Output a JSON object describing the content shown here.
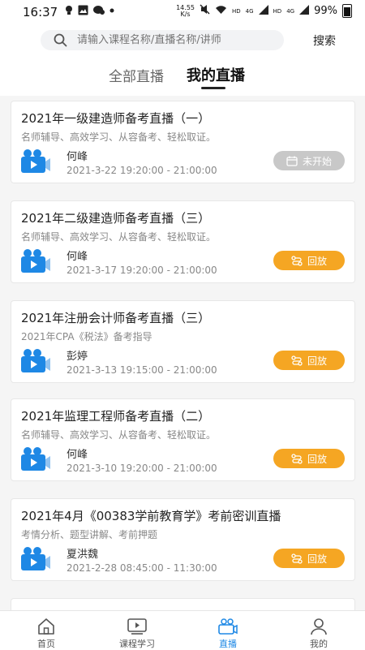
{
  "status_bar": {
    "time": "16:37",
    "net_speed_value": "14.55",
    "net_speed_unit": "K/s",
    "hd1": "HD",
    "signal1": "4G",
    "hd2": "HD",
    "signal2": "4G",
    "battery": "99%"
  },
  "search": {
    "placeholder": "请输入课程名称/直播名称/讲师",
    "button": "搜索"
  },
  "tabs": [
    {
      "label": "全部直播",
      "active": false
    },
    {
      "label": "我的直播",
      "active": true
    }
  ],
  "cards": [
    {
      "title": "2021年一级建造师备考直播（一）",
      "desc": "名师辅导、高效学习、从容备考、轻松取证。",
      "lecturer": "何峰",
      "time": "2021-3-22 19:20:00 - 21:00:00",
      "status": "未开始",
      "status_type": "pending"
    },
    {
      "title": "2021年二级建造师备考直播（三）",
      "desc": "名师辅导、高效学习、从容备考、轻松取证。",
      "lecturer": "何峰",
      "time": "2021-3-17 19:20:00 - 21:00:00",
      "status": "回放",
      "status_type": "replay"
    },
    {
      "title": "2021年注册会计师备考直播（三）",
      "desc": "2021年CPA《税法》备考指导",
      "lecturer": "彭婷",
      "time": "2021-3-13 19:15:00 - 21:00:00",
      "status": "回放",
      "status_type": "replay"
    },
    {
      "title": "2021年监理工程师备考直播（二）",
      "desc": "名师辅导、高效学习、从容备考、轻松取证。",
      "lecturer": "何峰",
      "time": "2021-3-10 19:20:00 - 21:00:00",
      "status": "回放",
      "status_type": "replay"
    },
    {
      "title": "2021年4月《00383学前教育学》考前密训直播",
      "desc": "考情分析、题型讲解、考前押题",
      "lecturer": "夏洪魏",
      "time": "2021-2-28 08:45:00 - 11:30:00",
      "status": "回放",
      "status_type": "replay"
    }
  ],
  "bottom_nav": [
    {
      "label": "首页",
      "icon": "home-icon"
    },
    {
      "label": "课程学习",
      "icon": "video-play-icon"
    },
    {
      "label": "直播",
      "icon": "live-camera-icon",
      "active": true
    },
    {
      "label": "我的",
      "icon": "user-icon"
    }
  ],
  "colors": {
    "accent": "#1e88e5",
    "replay": "#f5a623",
    "pending": "#c8c8c8"
  }
}
